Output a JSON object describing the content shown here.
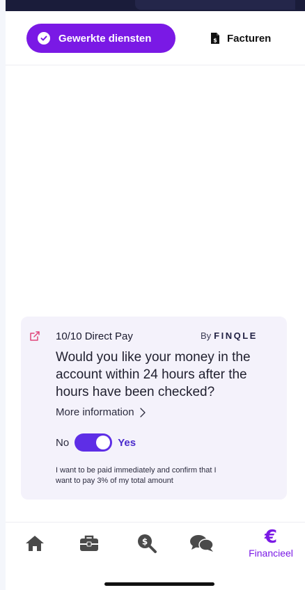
{
  "tabs": {
    "active_label": "Gewerkte diensten",
    "inactive_label": "Facturen"
  },
  "card": {
    "title": "10/10 Direct Pay",
    "by_prefix": "By",
    "brand": "FINQLE",
    "question": "Would you like your money in the account within 24 hours after the hours have been checked?",
    "more_info": "More information",
    "toggle_off_label": "No",
    "toggle_on_label": "Yes",
    "toggle_value": true,
    "note": "I want to be paid immediately and confirm that I want to pay 3% of my total amount"
  },
  "nav": {
    "items": [
      {
        "icon": "home-icon"
      },
      {
        "icon": "briefcase-icon"
      },
      {
        "icon": "money-search-icon"
      },
      {
        "icon": "chat-icon"
      },
      {
        "icon": "euro-icon",
        "symbol": "€",
        "label": "Financieel",
        "active": true
      }
    ]
  },
  "colors": {
    "accent": "#7a19e5",
    "toggle": "#5e2ee6",
    "card_bg": "#f4f2fb",
    "external_link": "#e0457b",
    "nav_icon": "#4a4a4a"
  }
}
